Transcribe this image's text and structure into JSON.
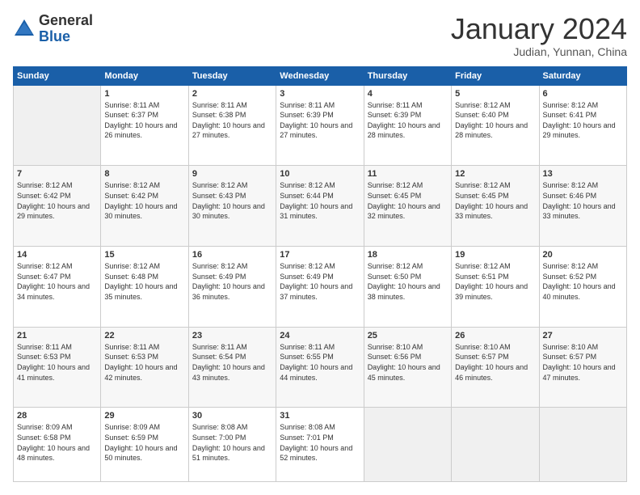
{
  "logo": {
    "general": "General",
    "blue": "Blue"
  },
  "header": {
    "month": "January 2024",
    "location": "Judian, Yunnan, China"
  },
  "days_of_week": [
    "Sunday",
    "Monday",
    "Tuesday",
    "Wednesday",
    "Thursday",
    "Friday",
    "Saturday"
  ],
  "weeks": [
    [
      {
        "day": "",
        "sunrise": "",
        "sunset": "",
        "daylight": ""
      },
      {
        "day": "1",
        "sunrise": "Sunrise: 8:11 AM",
        "sunset": "Sunset: 6:37 PM",
        "daylight": "Daylight: 10 hours and 26 minutes."
      },
      {
        "day": "2",
        "sunrise": "Sunrise: 8:11 AM",
        "sunset": "Sunset: 6:38 PM",
        "daylight": "Daylight: 10 hours and 27 minutes."
      },
      {
        "day": "3",
        "sunrise": "Sunrise: 8:11 AM",
        "sunset": "Sunset: 6:39 PM",
        "daylight": "Daylight: 10 hours and 27 minutes."
      },
      {
        "day": "4",
        "sunrise": "Sunrise: 8:11 AM",
        "sunset": "Sunset: 6:39 PM",
        "daylight": "Daylight: 10 hours and 28 minutes."
      },
      {
        "day": "5",
        "sunrise": "Sunrise: 8:12 AM",
        "sunset": "Sunset: 6:40 PM",
        "daylight": "Daylight: 10 hours and 28 minutes."
      },
      {
        "day": "6",
        "sunrise": "Sunrise: 8:12 AM",
        "sunset": "Sunset: 6:41 PM",
        "daylight": "Daylight: 10 hours and 29 minutes."
      }
    ],
    [
      {
        "day": "7",
        "sunrise": "Sunrise: 8:12 AM",
        "sunset": "Sunset: 6:42 PM",
        "daylight": "Daylight: 10 hours and 29 minutes."
      },
      {
        "day": "8",
        "sunrise": "Sunrise: 8:12 AM",
        "sunset": "Sunset: 6:42 PM",
        "daylight": "Daylight: 10 hours and 30 minutes."
      },
      {
        "day": "9",
        "sunrise": "Sunrise: 8:12 AM",
        "sunset": "Sunset: 6:43 PM",
        "daylight": "Daylight: 10 hours and 30 minutes."
      },
      {
        "day": "10",
        "sunrise": "Sunrise: 8:12 AM",
        "sunset": "Sunset: 6:44 PM",
        "daylight": "Daylight: 10 hours and 31 minutes."
      },
      {
        "day": "11",
        "sunrise": "Sunrise: 8:12 AM",
        "sunset": "Sunset: 6:45 PM",
        "daylight": "Daylight: 10 hours and 32 minutes."
      },
      {
        "day": "12",
        "sunrise": "Sunrise: 8:12 AM",
        "sunset": "Sunset: 6:45 PM",
        "daylight": "Daylight: 10 hours and 33 minutes."
      },
      {
        "day": "13",
        "sunrise": "Sunrise: 8:12 AM",
        "sunset": "Sunset: 6:46 PM",
        "daylight": "Daylight: 10 hours and 33 minutes."
      }
    ],
    [
      {
        "day": "14",
        "sunrise": "Sunrise: 8:12 AM",
        "sunset": "Sunset: 6:47 PM",
        "daylight": "Daylight: 10 hours and 34 minutes."
      },
      {
        "day": "15",
        "sunrise": "Sunrise: 8:12 AM",
        "sunset": "Sunset: 6:48 PM",
        "daylight": "Daylight: 10 hours and 35 minutes."
      },
      {
        "day": "16",
        "sunrise": "Sunrise: 8:12 AM",
        "sunset": "Sunset: 6:49 PM",
        "daylight": "Daylight: 10 hours and 36 minutes."
      },
      {
        "day": "17",
        "sunrise": "Sunrise: 8:12 AM",
        "sunset": "Sunset: 6:49 PM",
        "daylight": "Daylight: 10 hours and 37 minutes."
      },
      {
        "day": "18",
        "sunrise": "Sunrise: 8:12 AM",
        "sunset": "Sunset: 6:50 PM",
        "daylight": "Daylight: 10 hours and 38 minutes."
      },
      {
        "day": "19",
        "sunrise": "Sunrise: 8:12 AM",
        "sunset": "Sunset: 6:51 PM",
        "daylight": "Daylight: 10 hours and 39 minutes."
      },
      {
        "day": "20",
        "sunrise": "Sunrise: 8:12 AM",
        "sunset": "Sunset: 6:52 PM",
        "daylight": "Daylight: 10 hours and 40 minutes."
      }
    ],
    [
      {
        "day": "21",
        "sunrise": "Sunrise: 8:11 AM",
        "sunset": "Sunset: 6:53 PM",
        "daylight": "Daylight: 10 hours and 41 minutes."
      },
      {
        "day": "22",
        "sunrise": "Sunrise: 8:11 AM",
        "sunset": "Sunset: 6:53 PM",
        "daylight": "Daylight: 10 hours and 42 minutes."
      },
      {
        "day": "23",
        "sunrise": "Sunrise: 8:11 AM",
        "sunset": "Sunset: 6:54 PM",
        "daylight": "Daylight: 10 hours and 43 minutes."
      },
      {
        "day": "24",
        "sunrise": "Sunrise: 8:11 AM",
        "sunset": "Sunset: 6:55 PM",
        "daylight": "Daylight: 10 hours and 44 minutes."
      },
      {
        "day": "25",
        "sunrise": "Sunrise: 8:10 AM",
        "sunset": "Sunset: 6:56 PM",
        "daylight": "Daylight: 10 hours and 45 minutes."
      },
      {
        "day": "26",
        "sunrise": "Sunrise: 8:10 AM",
        "sunset": "Sunset: 6:57 PM",
        "daylight": "Daylight: 10 hours and 46 minutes."
      },
      {
        "day": "27",
        "sunrise": "Sunrise: 8:10 AM",
        "sunset": "Sunset: 6:57 PM",
        "daylight": "Daylight: 10 hours and 47 minutes."
      }
    ],
    [
      {
        "day": "28",
        "sunrise": "Sunrise: 8:09 AM",
        "sunset": "Sunset: 6:58 PM",
        "daylight": "Daylight: 10 hours and 48 minutes."
      },
      {
        "day": "29",
        "sunrise": "Sunrise: 8:09 AM",
        "sunset": "Sunset: 6:59 PM",
        "daylight": "Daylight: 10 hours and 50 minutes."
      },
      {
        "day": "30",
        "sunrise": "Sunrise: 8:08 AM",
        "sunset": "Sunset: 7:00 PM",
        "daylight": "Daylight: 10 hours and 51 minutes."
      },
      {
        "day": "31",
        "sunrise": "Sunrise: 8:08 AM",
        "sunset": "Sunset: 7:01 PM",
        "daylight": "Daylight: 10 hours and 52 minutes."
      },
      {
        "day": "",
        "sunrise": "",
        "sunset": "",
        "daylight": ""
      },
      {
        "day": "",
        "sunrise": "",
        "sunset": "",
        "daylight": ""
      },
      {
        "day": "",
        "sunrise": "",
        "sunset": "",
        "daylight": ""
      }
    ]
  ]
}
